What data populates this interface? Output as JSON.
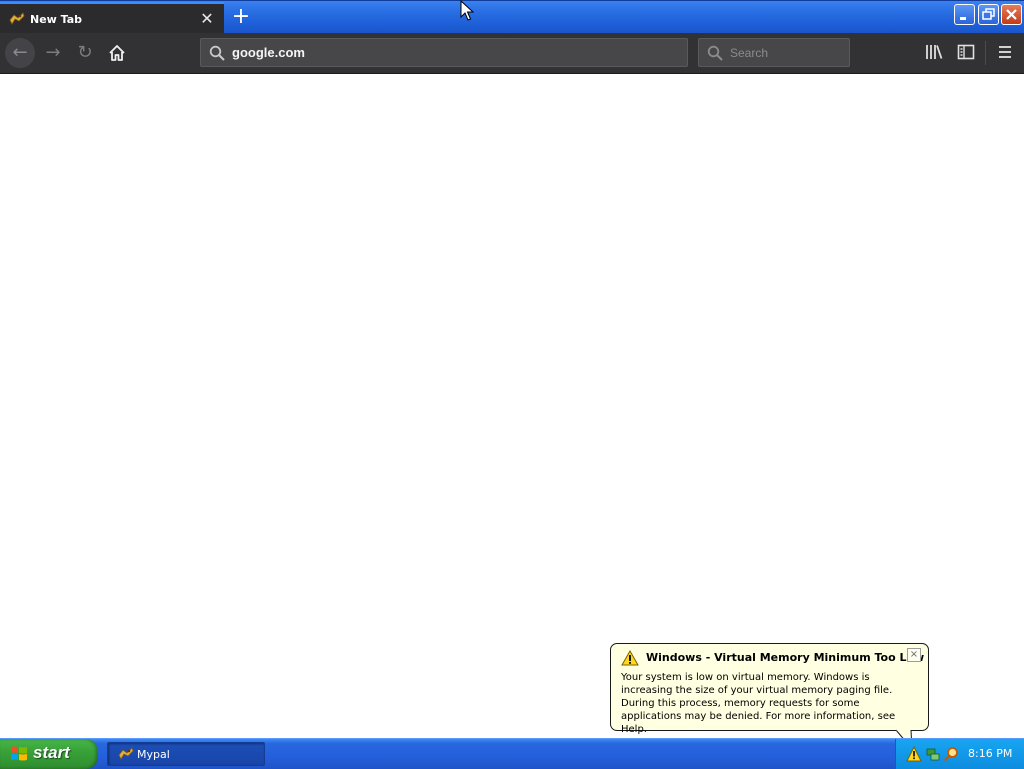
{
  "browser": {
    "tab": {
      "title": "New Tab",
      "favicon": "mypal-icon",
      "close_glyph": "✕"
    },
    "new_tab_glyph": "+",
    "window_controls": {
      "minimize": "minimize-icon",
      "maximize": "restore-icon",
      "close": "close-icon"
    },
    "toolbar": {
      "back_glyph": "←",
      "forward_glyph": "→",
      "reload_glyph": "↻",
      "home_icon": "home-icon",
      "url_value": "google.com",
      "search_placeholder": "Search",
      "icons": [
        "library-icon",
        "sidebar-icon",
        "hamburger-menu-icon"
      ]
    },
    "colors": {
      "toolbar": "#323234",
      "tab": "#2b2b2e",
      "accent": "#3a8cff"
    }
  },
  "balloon": {
    "icon": "warning-icon",
    "title": "Windows - Virtual Memory Minimum Too Low",
    "close_glyph": "×",
    "body": "Your system is low on virtual memory. Windows is increasing the size of your virtual memory paging file. During this process, memory requests for some applications may be denied. For more information, see Help.",
    "background": "#ffffe1"
  },
  "taskbar": {
    "start_label": "start",
    "items": [
      {
        "label": "Mypal",
        "icon": "mypal-icon"
      }
    ],
    "tray_icons": [
      "warning-icon",
      "network-icon",
      "search-icon"
    ],
    "clock": "8:16 PM"
  }
}
